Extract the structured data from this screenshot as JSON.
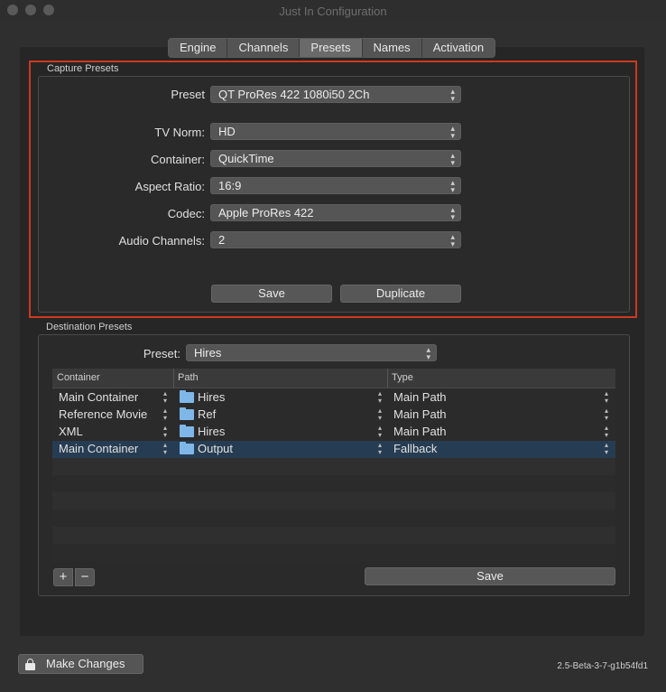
{
  "window": {
    "title": "Just In Configuration"
  },
  "tabs": [
    "Engine",
    "Channels",
    "Presets",
    "Names",
    "Activation"
  ],
  "capture": {
    "group_label": "Capture Presets",
    "preset_label": "Preset",
    "preset_value": "QT ProRes 422 1080i50 2Ch",
    "fields": [
      {
        "label": "TV Norm:",
        "value": "HD"
      },
      {
        "label": "Container:",
        "value": "QuickTime"
      },
      {
        "label": "Aspect Ratio:",
        "value": "16:9"
      },
      {
        "label": "Codec:",
        "value": "Apple ProRes 422"
      },
      {
        "label": "Audio Channels:",
        "value": "2"
      }
    ],
    "save_label": "Save",
    "duplicate_label": "Duplicate"
  },
  "destination": {
    "group_label": "Destination Presets",
    "preset_label": "Preset:",
    "preset_value": "Hires",
    "columns": [
      "Container",
      "Path",
      "Type"
    ],
    "rows": [
      {
        "container": "Main Container",
        "path": "Hires",
        "type": "Main Path"
      },
      {
        "container": "Reference Movie",
        "path": "Ref",
        "type": "Main Path"
      },
      {
        "container": "XML",
        "path": "Hires",
        "type": "Main Path"
      },
      {
        "container": "Main Container",
        "path": "Output",
        "type": "Fallback"
      }
    ],
    "add_label": "+",
    "remove_label": "−",
    "save_label": "Save"
  },
  "footer": {
    "make_changes_label": "Make Changes",
    "version": "2.5-Beta-3-7-g1b54fd1"
  },
  "colors": {
    "highlight": "#cc3a1f",
    "folder": "#7fb8e8",
    "selected_row": "#263c52"
  }
}
